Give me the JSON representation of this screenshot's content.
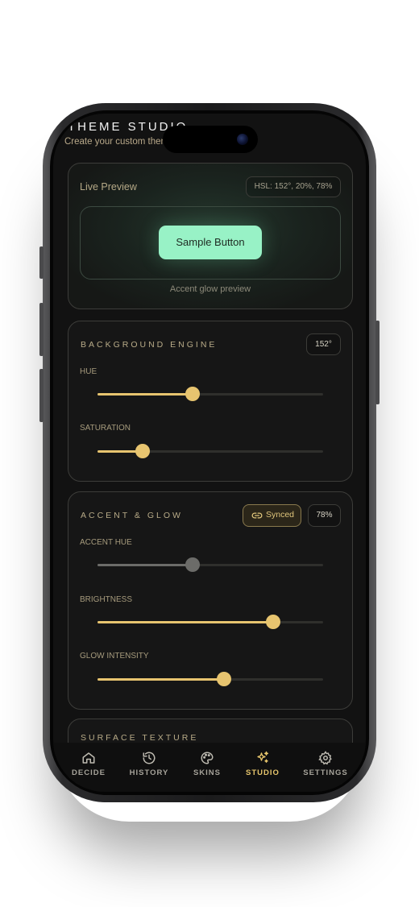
{
  "header": {
    "title": "THEME STUDIO",
    "subtitle": "Create your custom theme"
  },
  "live_preview": {
    "title": "Live Preview",
    "hsl_badge": "HSL: 152°, 20%, 78%",
    "sample_button_label": "Sample Button",
    "caption": "Accent glow preview"
  },
  "background_engine": {
    "title": "BACKGROUND ENGINE",
    "badge": "152°",
    "hue_label": "HUE",
    "hue_value": 0.42,
    "saturation_label": "SATURATION",
    "saturation_value": 0.2
  },
  "accent_glow": {
    "title": "ACCENT & GLOW",
    "synced_label": "Synced",
    "badge": "78%",
    "accent_hue_label": "ACCENT HUE",
    "accent_hue_value": 0.42,
    "brightness_label": "BRIGHTNESS",
    "brightness_value": 0.78,
    "glow_label": "GLOW INTENSITY",
    "glow_value": 0.56
  },
  "surface_texture": {
    "title": "SURFACE TEXTURE"
  },
  "tabs": [
    {
      "label": "DECIDE",
      "icon": "home-icon"
    },
    {
      "label": "HISTORY",
      "icon": "history-icon"
    },
    {
      "label": "SKINS",
      "icon": "palette-icon"
    },
    {
      "label": "STUDIO",
      "icon": "sparkles-icon",
      "active": true
    },
    {
      "label": "SETTINGS",
      "icon": "gear-icon"
    }
  ],
  "colors": {
    "accent": "#e7c46f",
    "preview_button": "#98f2c6",
    "background": "#121212"
  }
}
